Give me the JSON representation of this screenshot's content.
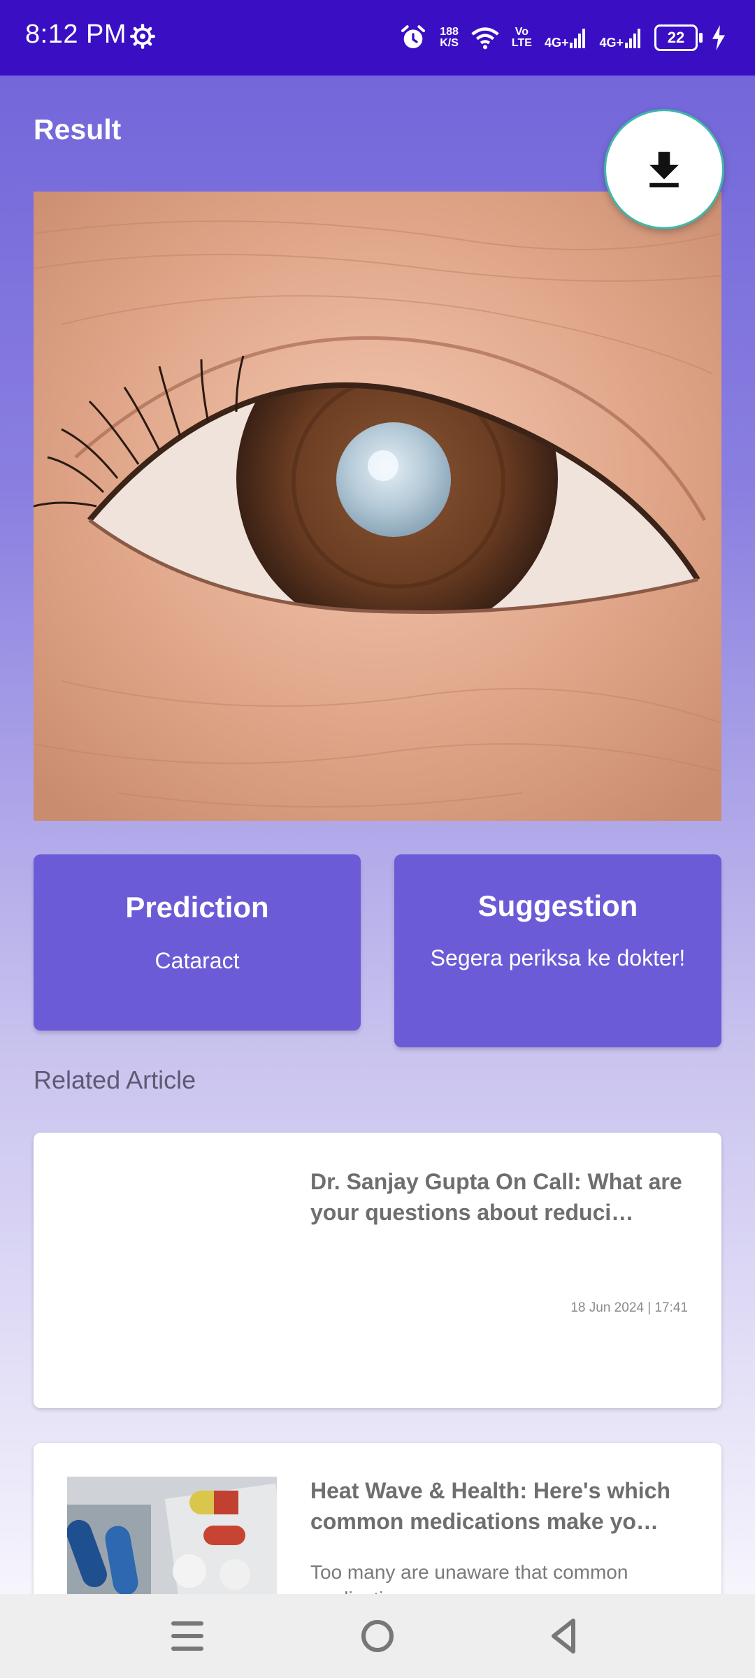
{
  "status_bar": {
    "time": "8:12 PM",
    "net_speed_value": "188",
    "net_speed_unit": "K/S",
    "volte_top": "Vo",
    "volte_bottom": "LTE",
    "signal1_label": "4G+",
    "signal2_label": "4G+",
    "battery": "22"
  },
  "page": {
    "title": "Result"
  },
  "icons": {
    "download": "download-icon",
    "settings": "gear-icon",
    "alarm": "alarm-icon",
    "wifi": "wifi-icon",
    "charging": "bolt-icon"
  },
  "prediction": {
    "title": "Prediction",
    "value": "Cataract"
  },
  "suggestion": {
    "title": "Suggestion",
    "value": "Segera periksa ke dokter!"
  },
  "related": {
    "label": "Related Article",
    "articles": [
      {
        "title": "Dr. Sanjay Gupta On Call: What are your questions about reduci…",
        "date": "18 Jun 2024 | 17:41"
      },
      {
        "title": "Heat Wave & Health: Here's which common medications make yo…",
        "description": "Too many are unaware that common medications..."
      }
    ]
  },
  "colors": {
    "status_bar": "#3a0fc4",
    "card": "#6b5bd6",
    "fab_border": "#3fb8a9"
  }
}
